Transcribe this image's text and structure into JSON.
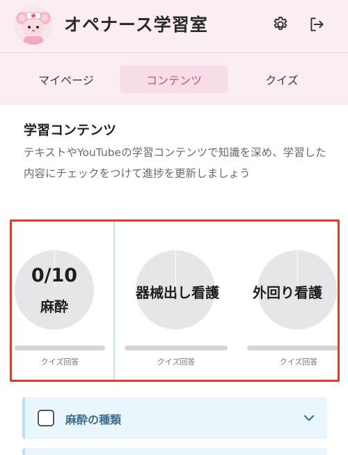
{
  "header": {
    "app_title": "オペナース学習室",
    "avatar_icon": "nurse-mouse-avatar",
    "settings_icon": "gear-icon",
    "logout_icon": "logout-icon"
  },
  "tabs": [
    {
      "label": "マイページ",
      "active": false
    },
    {
      "label": "コンテンツ",
      "active": true
    },
    {
      "label": "クイズ",
      "active": false
    }
  ],
  "section": {
    "title": "学習コンテンツ",
    "description": "テキストやYouTubeの学習コンテンツで知識を深め、学習した内容にチェックをつけて進捗を更新しましょう"
  },
  "cards": [
    {
      "score": "0/10",
      "name": "麻酔",
      "caption": "クイズ回答",
      "progress": 0
    },
    {
      "name": "器械出し看護",
      "caption": "クイズ回答",
      "progress": 0
    },
    {
      "name": "外回り看護",
      "caption": "クイズ回答",
      "progress": 0
    }
  ],
  "topics": [
    {
      "label": "麻酔の種類",
      "checked": false
    }
  ],
  "colors": {
    "header_bg": "#fbeef3",
    "accent": "#d0487c",
    "highlight_border": "#e23b26",
    "topic_bg": "#e9f6fc"
  }
}
